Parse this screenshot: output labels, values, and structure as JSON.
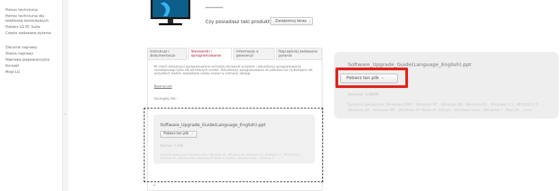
{
  "sidebar": {
    "support_links": [
      "Pomoc techniczna",
      "Pomoc techniczna dla",
      "telefonów komórkowych",
      "Pobierz LG PC Suite",
      "Często zadawane pytania"
    ],
    "service_links": [
      "Zlecenie naprawy",
      "Status naprawy",
      "Naprawa pogwarancyjna",
      "Kontakt",
      "Moje LG"
    ],
    "collapse_glyph": "‹"
  },
  "product": {
    "own_question": "Czy posiadasz taki produkt?",
    "register_label": "Zarejestruj teraz",
    "arrow": "›"
  },
  "tabs": [
    {
      "label": "Instrukcje i dokumentacja",
      "active": false
    },
    {
      "label": "Sterowniki i oprogramowanie",
      "active": true
    },
    {
      "label": "Informacje o gwarancji",
      "active": false
    },
    {
      "label": "Najczęściej zadawane pytania",
      "active": false
    }
  ],
  "content": {
    "notice": "W celach aktualizacji oprogramowania wchodzą sterowniki urządzeń i aktualizacje oprogramowania niezwiązanego tylko dla określonych modeli. Aktualizacje oprogramowania do pobrania nie są dostępne dla wszystkich modeli; wskazówek należy szukać w instrukcji obsługi.",
    "back_link": "Back to List",
    "details": "Szczegóły dot.:"
  },
  "file": {
    "name": "Software_Upgrade_Guide(Language_English).ppt",
    "download_label": "Pobierz ten plik",
    "size_small": "Rozmiar: 1.25M",
    "size_big": "Rozmiar: 2,06MK",
    "os_small": "Systemy operacyjne: Windows 2000 , Windows NT , Windows 98 , Windows 95 , Windows 3.1 , MS-DOS 6.0 , Windows XP , Windows ME , Windows XP Tablet PC Edition , Windows Vista , Windows 7",
    "os_big": "Systemy operacyjne: Windows 2000 , Windows NT , Windows 98 , Windows 95 , Windows 3.1 , MS-DOS 6.0 , Windows XP , Windows ME , Windows XP Tablet PC Edition , Windows Vista , Windows 7 , Mac OS , Linux"
  },
  "colors": {
    "active_tab": "#a3213a",
    "highlight": "#e2211c",
    "card_bg": "#eeeeee"
  }
}
